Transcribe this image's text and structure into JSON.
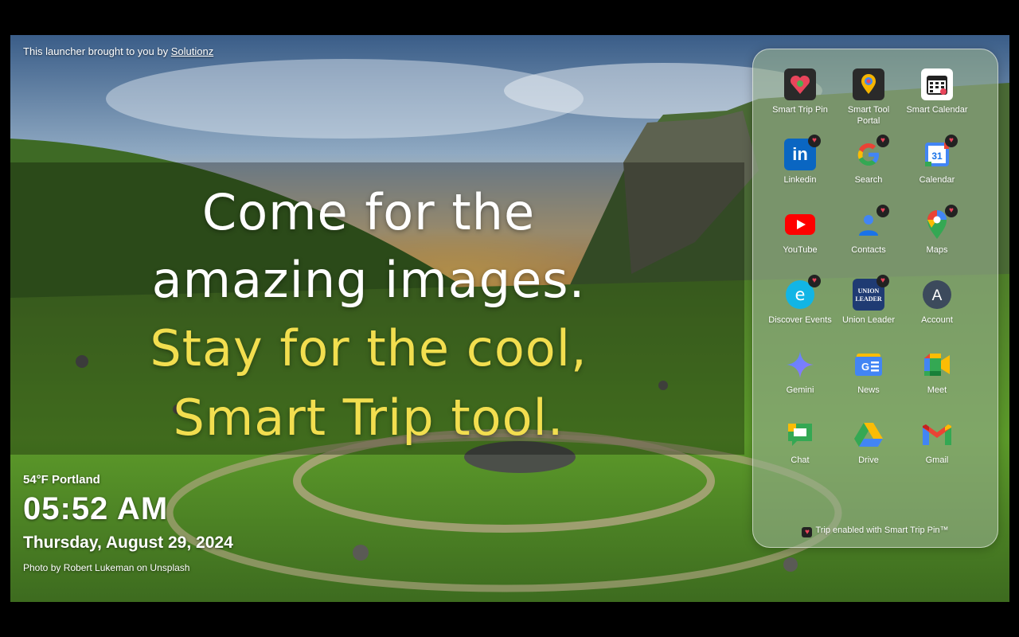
{
  "top_credit": {
    "prefix": "This launcher brought to you by ",
    "link": "Solutionz"
  },
  "hero": {
    "line1": "Come for the",
    "line2": "amazing images.",
    "line3": "Stay for the cool,",
    "line4": "Smart Trip tool."
  },
  "status": {
    "weather": "54°F Portland",
    "time": "05:52 AM",
    "date": "Thursday, August 29, 2024",
    "photo_credit": "Photo by Robert Lukeman on Unsplash"
  },
  "apps": [
    {
      "label": "Smart Trip Pin",
      "icon": "smart-trip-pin-icon"
    },
    {
      "label": "Smart Tool Portal",
      "icon": "smart-tool-portal-icon"
    },
    {
      "label": "Smart Calendar",
      "icon": "smart-calendar-icon"
    },
    {
      "label": "Linkedin",
      "icon": "linkedin-icon"
    },
    {
      "label": "Search",
      "icon": "google-search-icon"
    },
    {
      "label": "Calendar",
      "icon": "google-calendar-icon"
    },
    {
      "label": "YouTube",
      "icon": "youtube-icon"
    },
    {
      "label": "Contacts",
      "icon": "contacts-icon"
    },
    {
      "label": "Maps",
      "icon": "google-maps-icon"
    },
    {
      "label": "Discover Events",
      "icon": "discover-events-icon"
    },
    {
      "label": "Union Leader",
      "icon": "union-leader-icon"
    },
    {
      "label": "Account",
      "icon": "account-icon"
    },
    {
      "label": "Gemini",
      "icon": "gemini-icon"
    },
    {
      "label": "News",
      "icon": "google-news-icon"
    },
    {
      "label": "Meet",
      "icon": "google-meet-icon"
    },
    {
      "label": "Chat",
      "icon": "google-chat-icon"
    },
    {
      "label": "Drive",
      "icon": "google-drive-icon"
    },
    {
      "label": "Gmail",
      "icon": "gmail-icon"
    }
  ],
  "panel_footer": "Trip enabled with Smart Trip Pin™",
  "colors": {
    "hero_yellow": "#f2de4f",
    "badge_heart": "#e8455b"
  }
}
